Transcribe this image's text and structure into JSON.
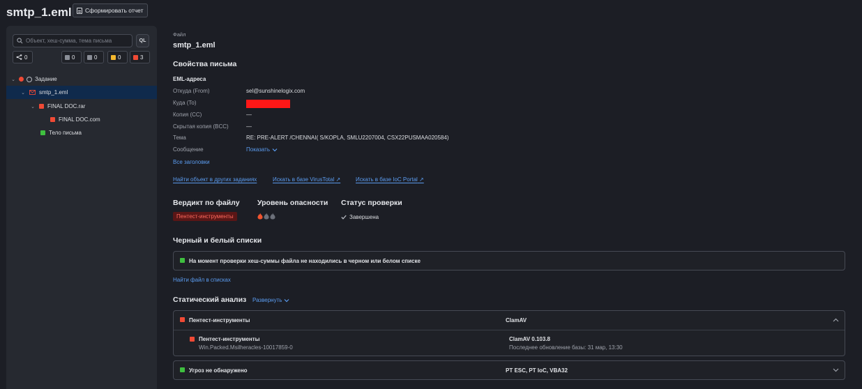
{
  "header": {
    "title": "smtp_1.eml",
    "report_button": "Сформировать отчет"
  },
  "sidebar": {
    "search_placeholder": "Объект, хеш-сумма, тема письма",
    "ql_label": "QL",
    "counters": {
      "links": "0",
      "gray": "0",
      "gray2": "0",
      "yellow": "0",
      "red": "3"
    },
    "tree": {
      "task": "Задание",
      "email": "smtp_1.eml",
      "archive": "FINAL DOC.rar",
      "inner": "FINAL DOC.com",
      "body": "Тело письма"
    }
  },
  "file": {
    "label": "Файл",
    "name": "smtp_1.eml"
  },
  "props": {
    "heading": "Свойства письма",
    "subheading": "EML-адреса",
    "from_label": "Откуда (From)",
    "from_value": "sel@sunshinelogix.com",
    "to_label": "Куда (To)",
    "cc_label": "Копия (CC)",
    "cc_value": "—",
    "bcc_label": "Скрытая копия (BCC)",
    "bcc_value": "—",
    "subject_label": "Тема",
    "subject_value": "RE: PRE-ALERT /CHENNAI( S/KOPLA, SMLU2207004, CSX22PUSMAA020584)",
    "message_label": "Сообщение",
    "message_value": "Показать",
    "all_headers": "Все заголовки"
  },
  "links": {
    "other_tasks": "Найти объект в других заданиях",
    "virustotal": "Искать в базе VirusTotal",
    "ioc_portal": "Искать в базе IoC Portal"
  },
  "verdict": {
    "label": "Вердикт по файлу",
    "value": "Пентест-инструменты",
    "danger_label": "Уровень опасности",
    "danger_level": "1 of 3",
    "status_label": "Статус проверки",
    "status_value": "Завершена"
  },
  "lists": {
    "heading": "Черный и белый списки",
    "message": "На момент проверки хеш-суммы файла не находились в черном или белом списке",
    "find_link": "Найти файл в списках"
  },
  "static": {
    "heading": "Статический анализ",
    "expand": "Развернуть",
    "row1_verdict": "Пентест-инструменты",
    "row1_engine": "ClamAV",
    "detail_verdict": "Пентест-инструменты",
    "detail_signature": "Win.Packed.Msilheracles-10017859-0",
    "detail_engine": "ClamAV 0.103.8",
    "detail_update": "Последнее обновление базы: 31 мар, 13:30",
    "row2_verdict": "Угроз не обнаружено",
    "row2_engine": "PT ESC, PT IoC, VBA32"
  },
  "colors": {
    "accent": "#5b9cf0",
    "danger": "#f04a35",
    "safe": "#3fbf3f",
    "warn": "#f5b82e"
  }
}
